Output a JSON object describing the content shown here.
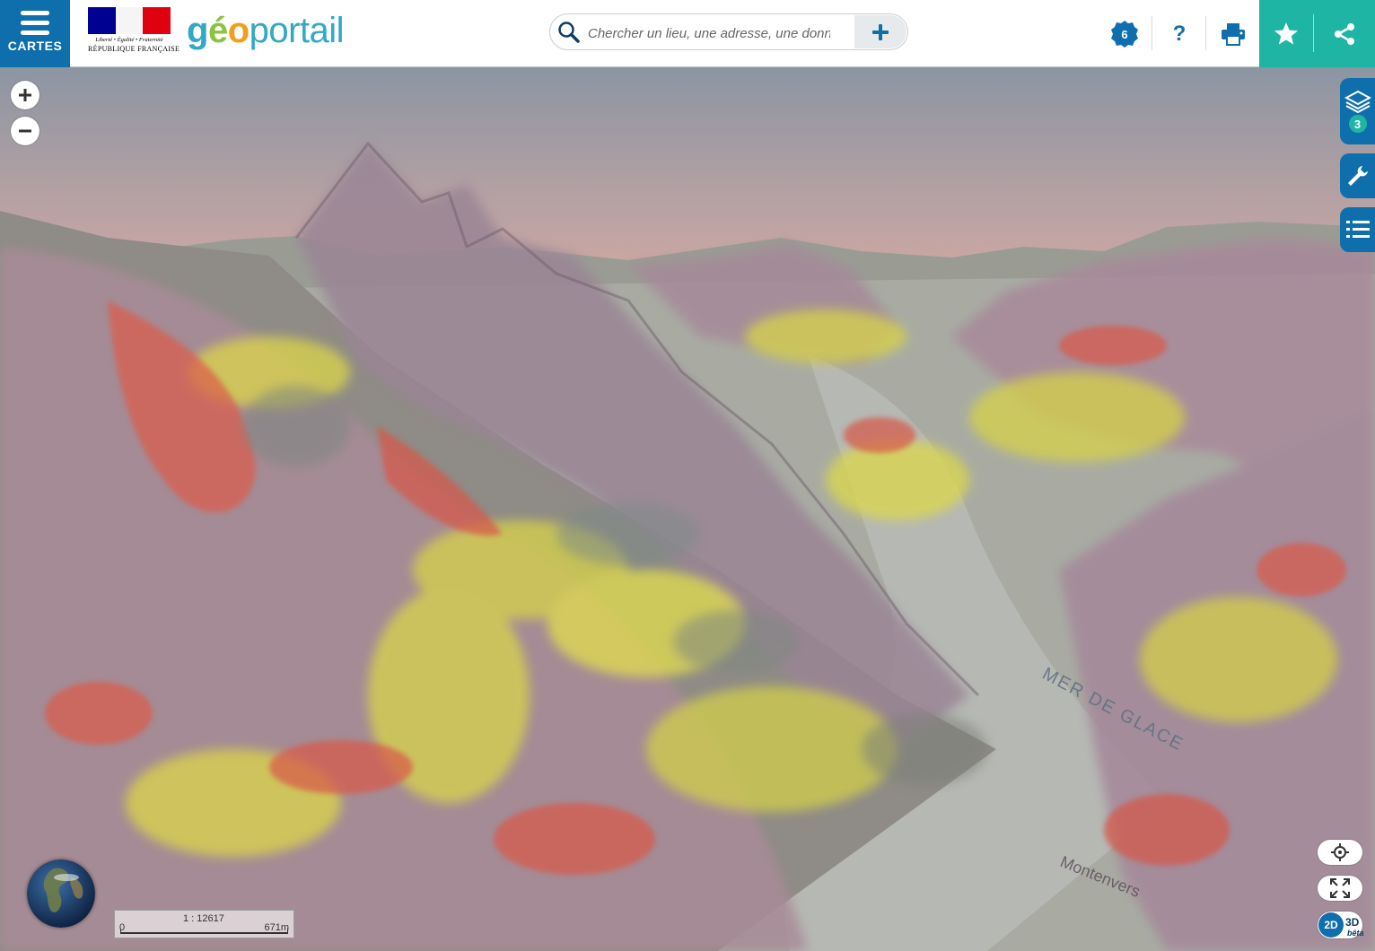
{
  "header": {
    "menu_label": "CARTES",
    "republic_motto": "Liberté • Égalité • Fraternité",
    "republic_name": "RÉPUBLIQUE FRANÇAISE",
    "brand": {
      "part1": "g",
      "part2": "é",
      "part3": "o",
      "part4": "portail"
    },
    "search": {
      "placeholder": "Chercher un lieu, une adresse, une donnée",
      "value": ""
    },
    "notifications_count": "6",
    "help_label": "?",
    "icons": [
      "menu-icon",
      "search-icon",
      "plus-icon",
      "notification-icon",
      "help-icon",
      "print-icon",
      "star-icon",
      "share-icon"
    ]
  },
  "map": {
    "layers_count": "3",
    "scale": {
      "ratio": "1 : 12617",
      "zero": "0",
      "distance": "671m"
    },
    "view_toggle": {
      "mode_2d": "2D",
      "mode_3d": "3D",
      "beta": "bêta"
    },
    "map_labels": [
      "MER DE GLACE",
      "Montenvers"
    ]
  },
  "colors": {
    "primary_blue": "#0f6fad",
    "teal": "#1fb5a5",
    "overlay_yellow": "#e6e04a",
    "overlay_red": "#e0564a",
    "overlay_mauve": "#a9859a"
  }
}
